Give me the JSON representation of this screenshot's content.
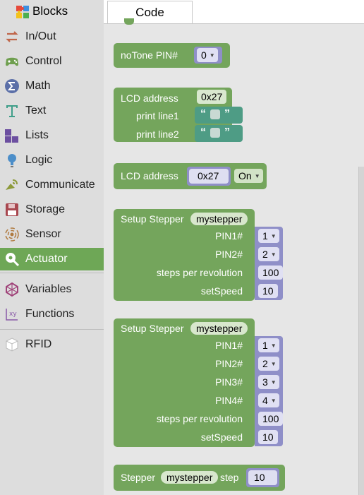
{
  "tabs": {
    "blocks": "Blocks",
    "code": "Code"
  },
  "categories": [
    {
      "label": "In/Out",
      "icon": "arrows-icon"
    },
    {
      "label": "Control",
      "icon": "gamepad-icon"
    },
    {
      "label": "Math",
      "icon": "sigma-icon"
    },
    {
      "label": "Text",
      "icon": "text-t-icon"
    },
    {
      "label": "Lists",
      "icon": "lists-icon"
    },
    {
      "label": "Logic",
      "icon": "bulb-icon"
    },
    {
      "label": "Communicate",
      "icon": "satellite-icon"
    },
    {
      "label": "Storage",
      "icon": "floppy-icon"
    },
    {
      "label": "Sensor",
      "icon": "sensor-icon"
    },
    {
      "label": "Actuator",
      "icon": "actuator-icon",
      "selected": true
    },
    {
      "label": "Variables",
      "icon": "variables-icon"
    },
    {
      "label": "Functions",
      "icon": "functions-icon"
    },
    {
      "label": "RFID",
      "icon": "cube-icon"
    }
  ],
  "blocks": {
    "notone": {
      "label": "noTone PIN#",
      "pin": "0"
    },
    "lcd_print": {
      "label": "LCD address",
      "address": "0x27",
      "line1": "print line1",
      "line2": "print line2"
    },
    "lcd_onoff": {
      "label": "LCD address",
      "address": "0x27",
      "state": "On"
    },
    "stepper2": {
      "label": "Setup Stepper",
      "name": "mystepper",
      "pin1_label": "PIN1#",
      "pin1": "1",
      "pin2_label": "PIN2#",
      "pin2": "2",
      "steps_label": "steps per revolution",
      "steps": "100",
      "speed_label": "setSpeed",
      "speed": "10"
    },
    "stepper4": {
      "label": "Setup Stepper",
      "name": "mystepper",
      "pin1_label": "PIN1#",
      "pin1": "1",
      "pin2_label": "PIN2#",
      "pin2": "2",
      "pin3_label": "PIN3#",
      "pin3": "3",
      "pin4_label": "PIN4#",
      "pin4": "4",
      "steps_label": "steps per revolution",
      "steps": "100",
      "speed_label": "setSpeed",
      "speed": "10"
    },
    "stepper_step": {
      "label": "Stepper",
      "name": "mystepper",
      "step_label": "step",
      "steps": "10"
    }
  },
  "colors": {
    "block_green": "#74a55c",
    "selected_category": "#6ea756",
    "text_block": "#4e9c85"
  }
}
